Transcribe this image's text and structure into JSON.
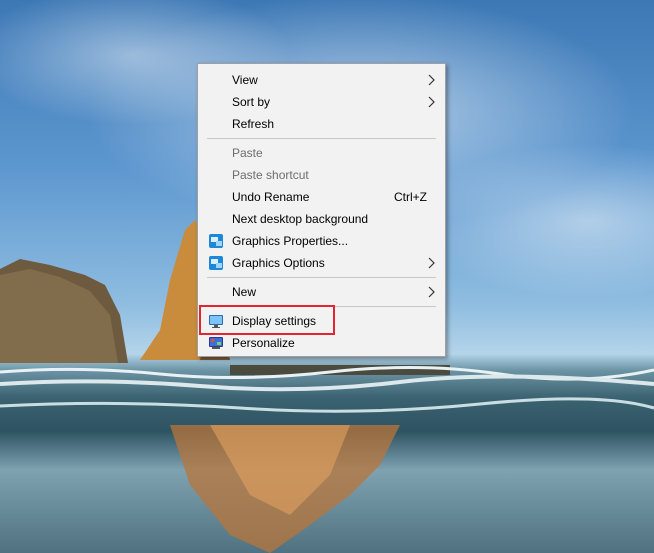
{
  "menu": {
    "view": "View",
    "sort_by": "Sort by",
    "refresh": "Refresh",
    "paste": "Paste",
    "paste_shortcut": "Paste shortcut",
    "undo_rename": "Undo Rename",
    "undo_shortcut": "Ctrl+Z",
    "next_background": "Next desktop background",
    "graphics_properties": "Graphics Properties...",
    "graphics_options": "Graphics Options",
    "new": "New",
    "display_settings": "Display settings",
    "personalize": "Personalize"
  },
  "icons": {
    "submenu": "chevron-right-icon",
    "graphics_properties": "graphics-properties-icon",
    "graphics_options": "graphics-options-icon",
    "display_settings": "monitor-icon",
    "personalize": "personalize-icon"
  },
  "colors": {
    "menu_background": "#f2f2f2",
    "disabled_text": "#6d6d6d",
    "highlight_box": "#e0262f"
  }
}
